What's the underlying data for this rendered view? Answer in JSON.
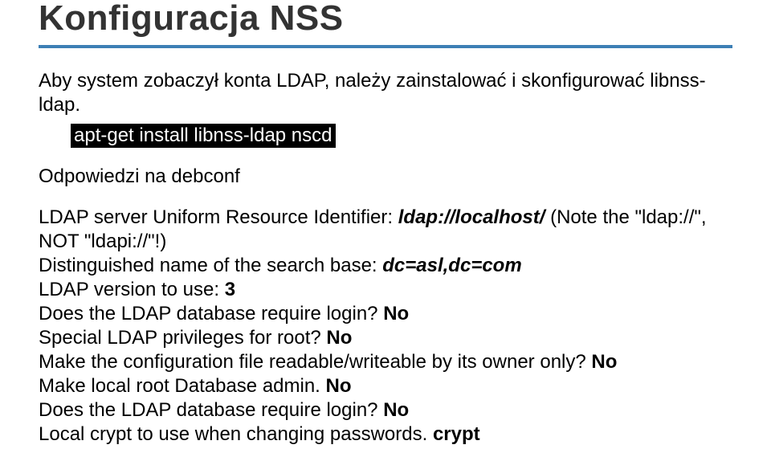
{
  "title": "Konfiguracja NSS",
  "lead": "Aby system zobaczył konta LDAP, należy zainstalować i skonfigurować libnss-ldap.",
  "command": "apt-get install libnss-ldap nscd",
  "subhead": "Odpowiedzi na debconf",
  "qa": {
    "l1_a": "LDAP server Uniform Resource Identifier: ",
    "l1_b": "ldap://localhost/",
    "l1_c": " (Note the \"ldap://\", NOT \"ldapi://\"!)",
    "l2_a": "Distinguished name of the search base: ",
    "l2_b": "dc=asl,dc=com",
    "l3_a": "LDAP version to use: ",
    "l3_b": "3",
    "l4_a": "Does the LDAP database require login? ",
    "l4_b": "No",
    "l5_a": "Special LDAP privileges for root? ",
    "l5_b": "No",
    "l6_a": "Make the configuration file readable/writeable by its owner only? ",
    "l6_b": "No",
    "l7_a": "Make local root Database admin. ",
    "l7_b": "No",
    "l8_a": "Does the LDAP database require login? ",
    "l8_b": "No",
    "l9_a": "Local crypt to use when changing passwords. ",
    "l9_b": "crypt"
  }
}
